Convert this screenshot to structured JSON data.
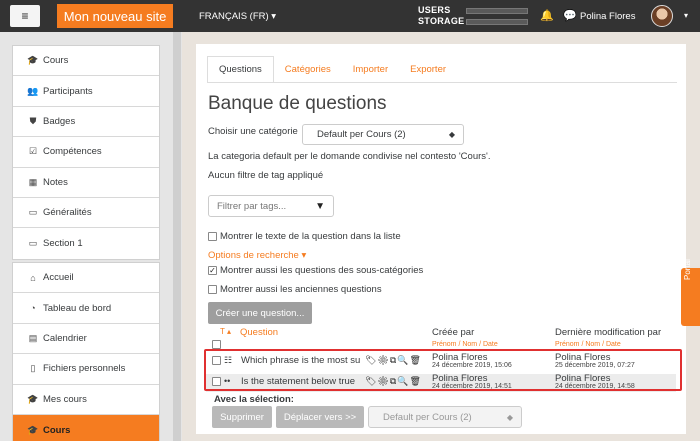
{
  "topbar": {
    "menu_icon": "hamburger-icon",
    "site_name": "Mon nouveau site",
    "language": "FRANÇAIS (FR) ▾",
    "users_label": "USERS",
    "storage_label": "STORAGE",
    "user_name": "Polina Flores",
    "caret": "▾",
    "bell": "🔔",
    "chat": "💬"
  },
  "sidebar": {
    "group1": [
      {
        "icon": "🎓",
        "label": "Cours"
      },
      {
        "icon": "👥",
        "label": "Participants"
      },
      {
        "icon": "⛊",
        "label": "Badges"
      },
      {
        "icon": "☑",
        "label": "Compétences"
      },
      {
        "icon": "▦",
        "label": "Notes"
      },
      {
        "icon": "▭",
        "label": "Généralités"
      },
      {
        "icon": "▭",
        "label": "Section 1"
      }
    ],
    "group2": [
      {
        "icon": "⌂",
        "label": "Accueil"
      },
      {
        "icon": "◔",
        "label": "Tableau de bord"
      },
      {
        "icon": "▤",
        "label": "Calendrier"
      },
      {
        "icon": "▯",
        "label": "Fichiers personnels"
      },
      {
        "icon": "🎓",
        "label": "Mes cours"
      },
      {
        "icon": "🎓",
        "label": "Cours"
      }
    ]
  },
  "tabs": [
    "Questions",
    "Catégories",
    "Importer",
    "Exporter"
  ],
  "page": {
    "title": "Banque de questions",
    "category_label": "Choisir une catégorie",
    "category_value": "Default per Cours (2)",
    "category_desc": "La categoria default per le domande condivise nel contesto 'Cours'.",
    "no_tag_filter": "Aucun filtre de tag appliqué",
    "tag_filter_placeholder": "Filtrer par tags...",
    "opt_show_text": "Montrer le texte de la question dans la liste",
    "search_options": "Options de recherche ▾",
    "opt_subcat": "Montrer aussi les questions des sous-catégories",
    "opt_old": "Montrer aussi les anciennes questions",
    "create_button": "Créer une question..."
  },
  "table": {
    "sort_type": "T ▴",
    "col_question": "Question",
    "col_created": "Créée par",
    "col_created_sub": "Prénom / Nom / Date",
    "col_modified": "Dernière modification par",
    "col_modified_sub": "Prénom / Nom / Date",
    "rows": [
      {
        "type_icon": "☷",
        "text": "Which phrase is the most su",
        "actions": "🏷⚙⧉🔍🗑",
        "creator": "Polina Flores",
        "created": "24 décembre 2019, 15:06",
        "modifier": "Polina Flores",
        "modified": "25 décembre 2019, 07:27"
      },
      {
        "type_icon": "••",
        "text": "Is the statement below true",
        "actions": "🏷⚙⧉🔍🗑",
        "creator": "Polina Flores",
        "created": "24 décembre 2019, 14:51",
        "modifier": "Polina Flores",
        "modified": "24 décembre 2019, 14:58"
      }
    ]
  },
  "selection": {
    "label": "Avec la sélection:",
    "delete": "Supprimer",
    "move": "Déplacer vers >>",
    "target": "Default per Cours (2)"
  },
  "portal_tab": "Portal",
  "colors": {
    "accent": "#f57c20",
    "topbar": "#333333",
    "highlight": "#e03030"
  }
}
